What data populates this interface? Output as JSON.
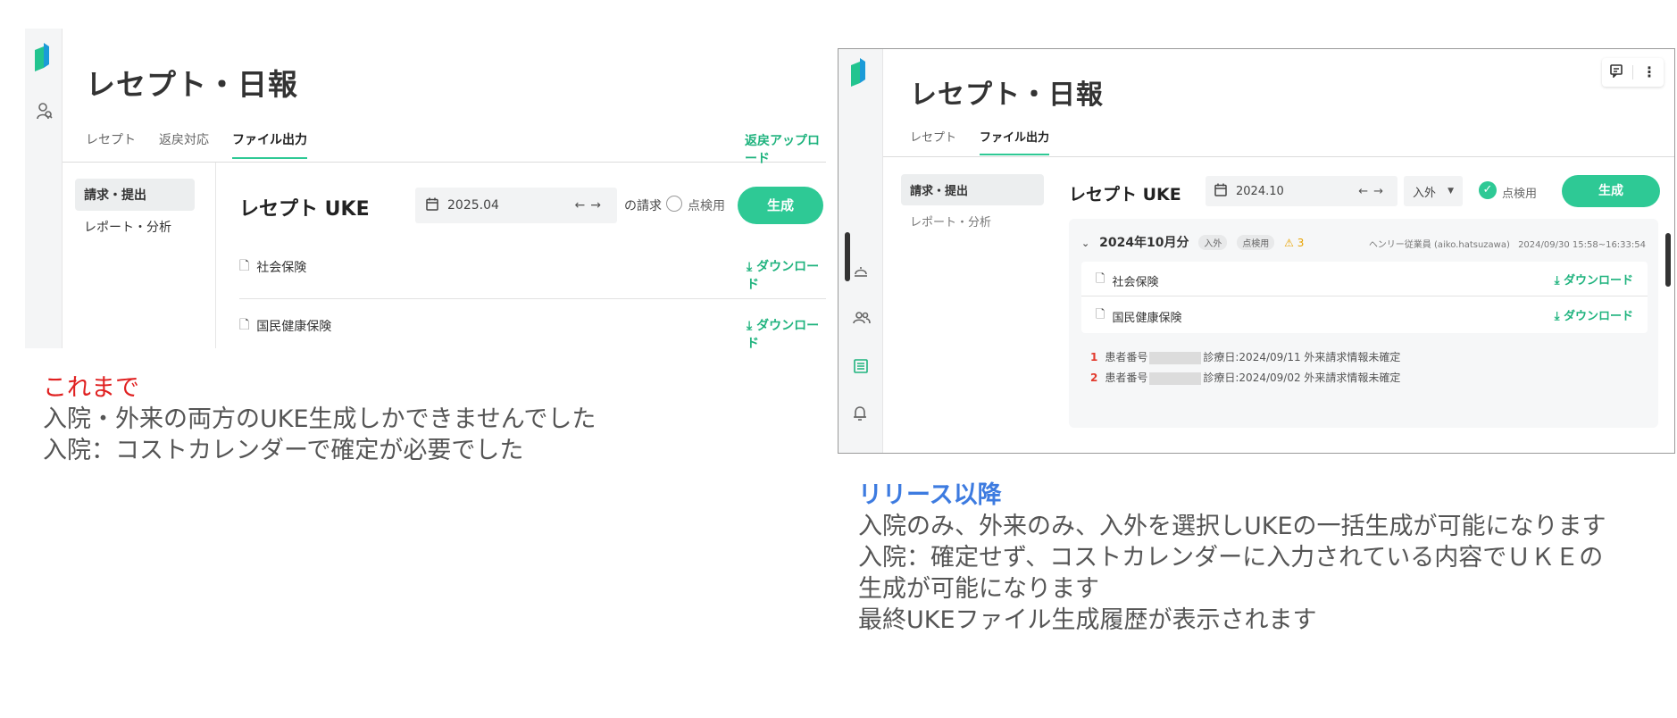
{
  "before": {
    "page_title": "レセプト・日報",
    "tabs": [
      "レセプト",
      "返戻対応",
      "ファイル出力"
    ],
    "active_tab": "ファイル出力",
    "return_upload_link": "返戻アップロード",
    "subnav": [
      "請求・提出",
      "レポート・分析"
    ],
    "section_title": "レセプト UKE",
    "date_value": "2025.04",
    "billing_suffix": "の請求",
    "check_label": "点検用",
    "generate_button": "生成",
    "files": [
      {
        "name": "社会保険",
        "action": "ダウンロード"
      },
      {
        "name": "国民健康保険",
        "action": "ダウンロード"
      }
    ],
    "icons": [
      "logo-icon",
      "user-search-icon",
      "calendar-icon",
      "arrow-left-icon",
      "arrow-right-icon",
      "document-icon",
      "download-icon"
    ]
  },
  "after": {
    "page_title": "レセプト・日報",
    "tabs": [
      "レセプト",
      "ファイル出力"
    ],
    "active_tab": "ファイル出力",
    "subnav": [
      "請求・提出",
      "レポート・分析"
    ],
    "section_title": "レセプト UKE",
    "date_value": "2024.10",
    "type_select": "入外",
    "check_label": "点検用",
    "generate_button": "生成",
    "history": {
      "month_label": "2024年10月分",
      "chips": [
        "入外",
        "点検用"
      ],
      "warning_count": "3",
      "staff": "ヘンリー従業員 (aiko.hatsuzawa)",
      "timestamp": "2024/09/30 15:58~16:33:54",
      "files": [
        {
          "name": "社会保険",
          "action": "ダウンロード"
        },
        {
          "name": "国民健康保険",
          "action": "ダウンロード"
        }
      ],
      "issues": [
        {
          "num": "1",
          "patient_label": "患者番号",
          "detail": "診療日:2024/09/11 外来請求情報未確定"
        },
        {
          "num": "2",
          "patient_label": "患者番号",
          "detail": "診療日:2024/09/02 外来請求情報未確定"
        }
      ]
    }
  },
  "captions": {
    "before": {
      "heading": "これまで",
      "heading_color": "#e02020",
      "lines": [
        "入院・外来の両方のUKE生成しかできませんでした",
        "入院：コストカレンダーで確定が必要でした"
      ]
    },
    "after": {
      "heading": "リリース以降",
      "heading_color": "#3d7be0",
      "lines": [
        "入院のみ、外来のみ、入外を選択しUKEの一括生成が可能になります",
        "入院：確定せず、コストカレンダーに入力されている内容でＵＫＥの",
        "生成が可能になります",
        "最終UKEファイル生成履歴が表示されます"
      ]
    }
  },
  "colors": {
    "accent": "#2ec995",
    "link": "#1fb37e"
  }
}
